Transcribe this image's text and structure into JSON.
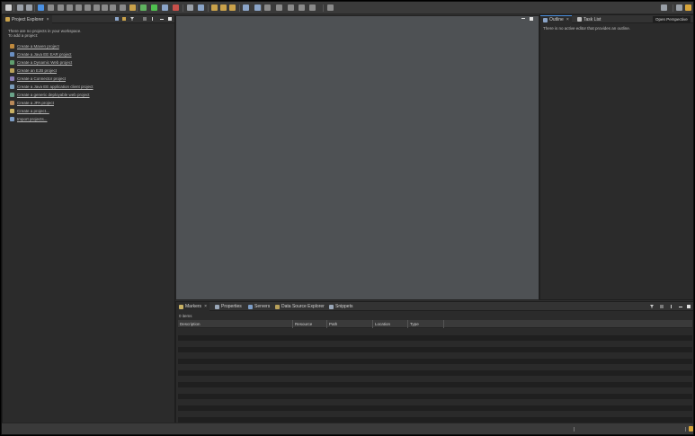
{
  "project_explorer": {
    "tab_label": "Project Explorer",
    "close_label": "×",
    "intro_line1": "There are no projects in your workspace.",
    "intro_line2": "To add a project:",
    "links": [
      {
        "label": "Create a Maven project",
        "icon": "maven-project-icon",
        "color": "#c08a3e"
      },
      {
        "label": "Create a Java EE EAR project",
        "icon": "ear-project-icon",
        "color": "#6a8fc2"
      },
      {
        "label": "Create a Dynamic Web project",
        "icon": "web-project-icon",
        "color": "#5f9e6e"
      },
      {
        "label": "Create an EJB project",
        "icon": "ejb-project-icon",
        "color": "#b9a15a"
      },
      {
        "label": "Create a Connector project",
        "icon": "connector-project-icon",
        "color": "#8a7fb8"
      },
      {
        "label": "Create a Java EE application client project",
        "icon": "app-client-project-icon",
        "color": "#7b9dbb"
      },
      {
        "label": "Create a generic deployable web project",
        "icon": "generic-web-project-icon",
        "color": "#6aa38a"
      },
      {
        "label": "Create a JPA project",
        "icon": "jpa-project-icon",
        "color": "#b98a5a"
      },
      {
        "label": "Create a project...",
        "icon": "new-project-icon",
        "color": "#c9b265"
      },
      {
        "label": "Import projects...",
        "icon": "import-projects-icon",
        "color": "#7e9ec7"
      }
    ]
  },
  "outline": {
    "tab_label": "Outline",
    "close_label": "×",
    "task_list_label": "Task List",
    "message": "There is no active editor that provides an outline."
  },
  "tooltip": {
    "text": "Open Perspective"
  },
  "bottom": {
    "tabs": [
      {
        "label": "Markers",
        "icon": "markers-icon",
        "color": "#c9b265"
      },
      {
        "label": "Properties",
        "icon": "properties-icon",
        "color": "#9aa7b8"
      },
      {
        "label": "Servers",
        "icon": "servers-icon",
        "color": "#7e9ec7"
      },
      {
        "label": "Data Source Explorer",
        "icon": "data-source-icon",
        "color": "#b9a15a"
      },
      {
        "label": "Snippets",
        "icon": "snippets-icon",
        "color": "#9aa7b8"
      }
    ],
    "close_label": "×",
    "items_count": "0 items",
    "columns": [
      "Description",
      "Resource",
      "Path",
      "Location",
      "Type"
    ]
  },
  "colors": {
    "accent": "#4a90e2",
    "editor_bg": "#4e5154",
    "panel_bg": "#2b2b2b"
  }
}
